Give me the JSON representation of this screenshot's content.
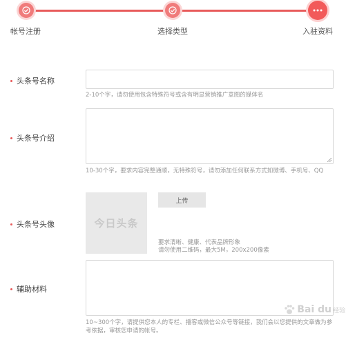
{
  "stepper": {
    "steps": [
      {
        "label": "帐号注册",
        "state": "done",
        "icon": "check-icon"
      },
      {
        "label": "选择类型",
        "state": "done",
        "icon": "check-icon"
      },
      {
        "label": "入驻资料",
        "state": "current",
        "icon": "ellipsis-icon"
      }
    ],
    "accent": "#e85a5a"
  },
  "form": {
    "name": {
      "label": "头条号名称",
      "hint": "2-10个字，请勿使用包含特殊符号或含有明显营销推广意图的媒体名"
    },
    "intro": {
      "label": "头条号介绍",
      "hint": "10-30个字，要求内容完整通顺，无特殊符号，请勿添加任何联系方式如微博、手机号、QQ"
    },
    "avatar": {
      "label": "头条号头像",
      "placeholder_text": "今日头条",
      "upload_label": "上传",
      "hint_line1": "要求清晰、健康、代表品牌形象",
      "hint_line2": "请勿使用二维码，最大5M，200x200像素"
    },
    "material": {
      "label": "辅助材料",
      "hint": "10~300个字，请提供您本人的专栏、播客或微信公众号等链接，我们会以您提供的文章做为参考依据，审核您申请的帐号。"
    }
  },
  "watermark": {
    "text": "Bai du",
    "sub": "经验"
  }
}
